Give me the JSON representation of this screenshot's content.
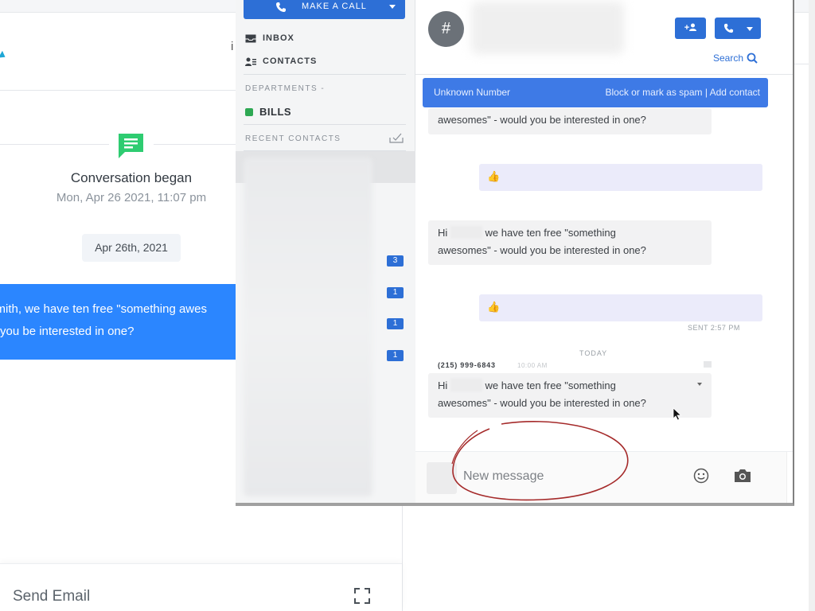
{
  "background_app": {
    "conversation_began": "Conversation began",
    "conversation_date": "Mon, Apr 26 2021, 11:07 pm",
    "date_chip": "Apr 26th, 2021",
    "sent_message_line1": "n Smith, we have ten free \"something awes",
    "sent_message_line2": "you be interested in one?",
    "send_email_label": "Send Email",
    "colors": {
      "accent_green": "#2ecc71",
      "bubble_blue": "#2b86ff"
    }
  },
  "phone": {
    "make_call_label": "MAKE A CALL",
    "nav": {
      "inbox": "INBOX",
      "contacts": "CONTACTS"
    },
    "departments_label": "DEPARTMENTS  -",
    "department_item": "BILLS",
    "recent_contacts_label": "RECENT CONTACTS",
    "badges": [
      "3",
      "1",
      "1",
      "1"
    ],
    "header": {
      "avatar_glyph": "#",
      "add_contact_glyph": "+",
      "search_label": "Search"
    },
    "banner": {
      "left": "Unknown Number",
      "right": "Block or mark as spam | Add contact"
    },
    "messages": {
      "msg1": "awesomes\" - would you be interested in one?",
      "msg2_line1a": "Hi",
      "msg2_line1b": "we have ten free \"something",
      "msg2_line2": "awesomes\" - would you be interested in one?",
      "reply_glyph": "👍",
      "sent_time": "SENT 2:57 PM",
      "today": "TODAY",
      "from_number": "(215) 999-6843",
      "from_time": "10:00 AM",
      "msg3_line1a": "Hi",
      "msg3_line1b": "we have ten free \"something",
      "msg3_line2": "awesomes\" - would you be interested in one?"
    },
    "composer": {
      "placeholder": "New message"
    },
    "colors": {
      "primary": "#2d6fd6",
      "department_dot": "#2ea853",
      "annotation": "#a52a2a"
    }
  }
}
